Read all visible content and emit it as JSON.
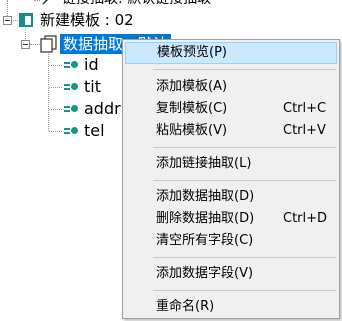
{
  "tree": {
    "top_partial_label": "链接抽取: 默认链接抽取",
    "template_label": "新建模板 : 02",
    "selected_label": "数据抽取 : 默认",
    "fields": [
      {
        "label": "id"
      },
      {
        "label": "tit"
      },
      {
        "label": "addr"
      },
      {
        "label": "tel"
      }
    ]
  },
  "context_menu": {
    "items": [
      {
        "label": "模板预览(P)",
        "shortcut": ""
      },
      {
        "label": "添加模板(A)",
        "shortcut": ""
      },
      {
        "label": "复制模板(C)",
        "shortcut": "Ctrl+C"
      },
      {
        "label": "粘贴模板(V)",
        "shortcut": "Ctrl+V"
      },
      {
        "label": "添加链接抽取(L)",
        "shortcut": ""
      },
      {
        "label": "添加数据抽取(D)",
        "shortcut": ""
      },
      {
        "label": "删除数据抽取(D)",
        "shortcut": "Ctrl+D"
      },
      {
        "label": "清空所有字段(C)",
        "shortcut": ""
      },
      {
        "label": "添加数据字段(V)",
        "shortcut": ""
      },
      {
        "label": "重命名(R)",
        "shortcut": ""
      }
    ]
  },
  "colors": {
    "selection": "#0078d7",
    "menu_highlight": "#cce8ff",
    "field_icon": "#15948c",
    "template_icon": "#1a8a8a"
  }
}
